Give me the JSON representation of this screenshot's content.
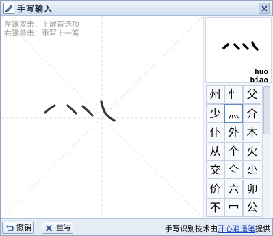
{
  "window": {
    "title": "手写输入"
  },
  "canvas": {
    "hint1": "左键双击：上屏首选项",
    "hint2": "右键单击：重写上一笔"
  },
  "preview": {
    "char_icon": "handwritten-strokes-glyph",
    "pinyin_line1": "huo",
    "pinyin_line2": "biao"
  },
  "candidates": [
    {
      "char": "州",
      "selected": false
    },
    {
      "char": "忄",
      "selected": false
    },
    {
      "char": "父",
      "selected": false
    },
    {
      "char": "少",
      "selected": false
    },
    {
      "char": "灬",
      "selected": true
    },
    {
      "char": "介",
      "selected": false
    },
    {
      "char": "仆",
      "selected": false
    },
    {
      "char": "外",
      "selected": false
    },
    {
      "char": "木",
      "selected": false
    },
    {
      "char": "从",
      "selected": false
    },
    {
      "char": "个",
      "selected": false
    },
    {
      "char": "火",
      "selected": false
    },
    {
      "char": "交",
      "selected": false
    },
    {
      "char": "亽",
      "selected": false
    },
    {
      "char": "尐",
      "selected": false
    },
    {
      "char": "价",
      "selected": false
    },
    {
      "char": "六",
      "selected": false
    },
    {
      "char": "卯",
      "selected": false
    },
    {
      "char": "不",
      "selected": false
    },
    {
      "char": "冖",
      "selected": false
    },
    {
      "char": "公",
      "selected": false
    }
  ],
  "footer": {
    "undo_label": "撤销",
    "rewrite_label": "重写",
    "credit_prefix": "手写识别技术由",
    "credit_link": "开心逍遥笔",
    "credit_suffix": "提供"
  },
  "colors": {
    "accent": "#5f86bf",
    "link": "#1a3fbf",
    "hint_text": "#a0a0a0"
  }
}
